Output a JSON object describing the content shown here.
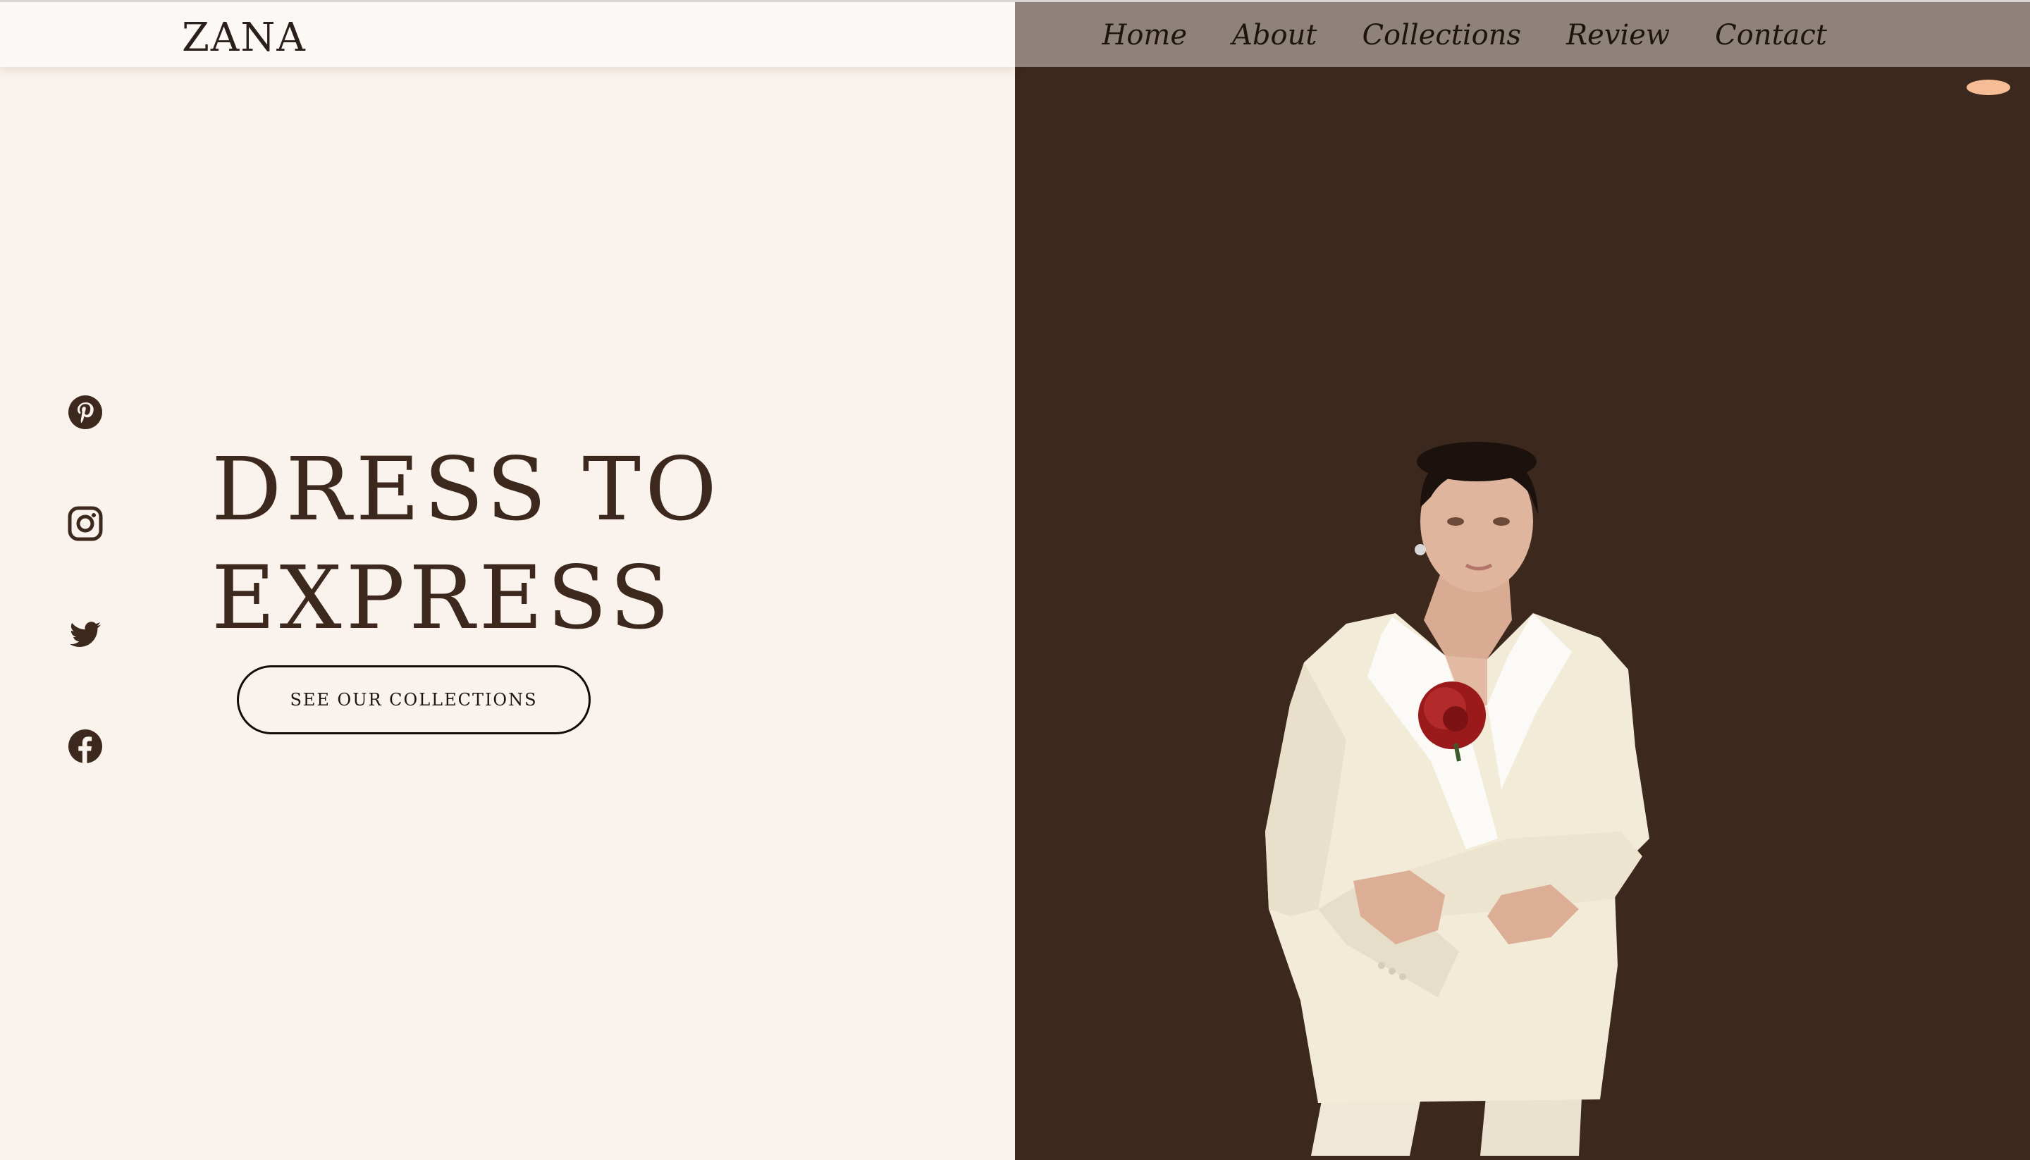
{
  "header": {
    "logo": "ZANA",
    "nav": [
      "Home",
      "About",
      "Collections",
      "Review",
      "Contact"
    ]
  },
  "hero": {
    "title_line1": "DRESS TO",
    "title_line2": "EXPRESS",
    "cta_label": "SEE OUR COLLECTIONS"
  },
  "socials": [
    {
      "icon": "pinterest-icon"
    },
    {
      "icon": "instagram-icon"
    },
    {
      "icon": "twitter-icon"
    },
    {
      "icon": "facebook-icon"
    }
  ],
  "colors": {
    "left_bg": "#faf2ec",
    "right_bg": "#3c281c",
    "header_right": "#8f827a",
    "accent": "#f6bc95",
    "text_dark": "#3c281c"
  }
}
